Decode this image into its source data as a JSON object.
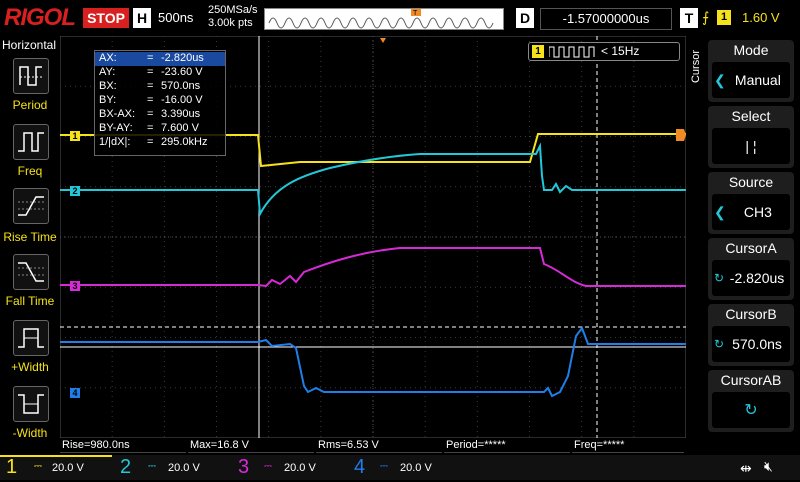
{
  "top": {
    "brand": "RIGOL",
    "run_state": "STOP",
    "h_label": "H",
    "timebase": "500ns",
    "sample_rate": "250MSa/s",
    "points": "3.00k pts",
    "d_label": "D",
    "delay": "-1.57000000us",
    "t_label": "T",
    "trigger_channel": "1",
    "trigger_level": "1.60 V"
  },
  "left_menu": {
    "title": "Horizontal",
    "items": [
      {
        "label": "Period"
      },
      {
        "label": "Freq"
      },
      {
        "label": "Rise Time"
      },
      {
        "label": "Fall Time"
      },
      {
        "label": "+Width"
      },
      {
        "label": "-Width"
      }
    ]
  },
  "right_menu": {
    "side_title": "Cursor",
    "panels": [
      {
        "title": "Mode",
        "value": "Manual"
      },
      {
        "title": "Select",
        "value": "|  ¦"
      },
      {
        "title": "Source",
        "value": "CH3"
      },
      {
        "title": "CursorA",
        "value": "-2.820us"
      },
      {
        "title": "CursorB",
        "value": "570.0ns"
      },
      {
        "title": "CursorAB",
        "value": ""
      }
    ]
  },
  "cursor_readout": [
    {
      "label": "AX:",
      "value": "-2.820us"
    },
    {
      "label": "AY:",
      "value": "-23.60 V"
    },
    {
      "label": "BX:",
      "value": "570.0ns"
    },
    {
      "label": "BY:",
      "value": "-16.00 V"
    },
    {
      "label": "BX-AX:",
      "value": "3.390us"
    },
    {
      "label": "BY-AY:",
      "value": "7.600 V"
    },
    {
      "label": "1/|dX|:",
      "value": "295.0kHz"
    }
  ],
  "freq_counter": {
    "channel": "1",
    "value": "< 15Hz"
  },
  "measurements": [
    {
      "text": "Rise=980.0ns"
    },
    {
      "text": "Max=16.8 V"
    },
    {
      "text": "Rms=6.53 V"
    },
    {
      "text": "Period=*****"
    },
    {
      "text": "Freq=*****"
    }
  ],
  "channels": [
    {
      "num": "1",
      "scale": "20.0 V",
      "color": "#f5e21a"
    },
    {
      "num": "2",
      "scale": "20.0 V",
      "color": "#22c7d8"
    },
    {
      "num": "3",
      "scale": "20.0 V",
      "color": "#d62ad6"
    },
    {
      "num": "4",
      "scale": "20.0 V",
      "color": "#1f7ee8"
    }
  ],
  "colors": {
    "ch1": "#f5e21a",
    "ch2": "#22c7d8",
    "ch3": "#d62ad6",
    "ch4": "#1f7ee8",
    "brand": "#d82020"
  }
}
